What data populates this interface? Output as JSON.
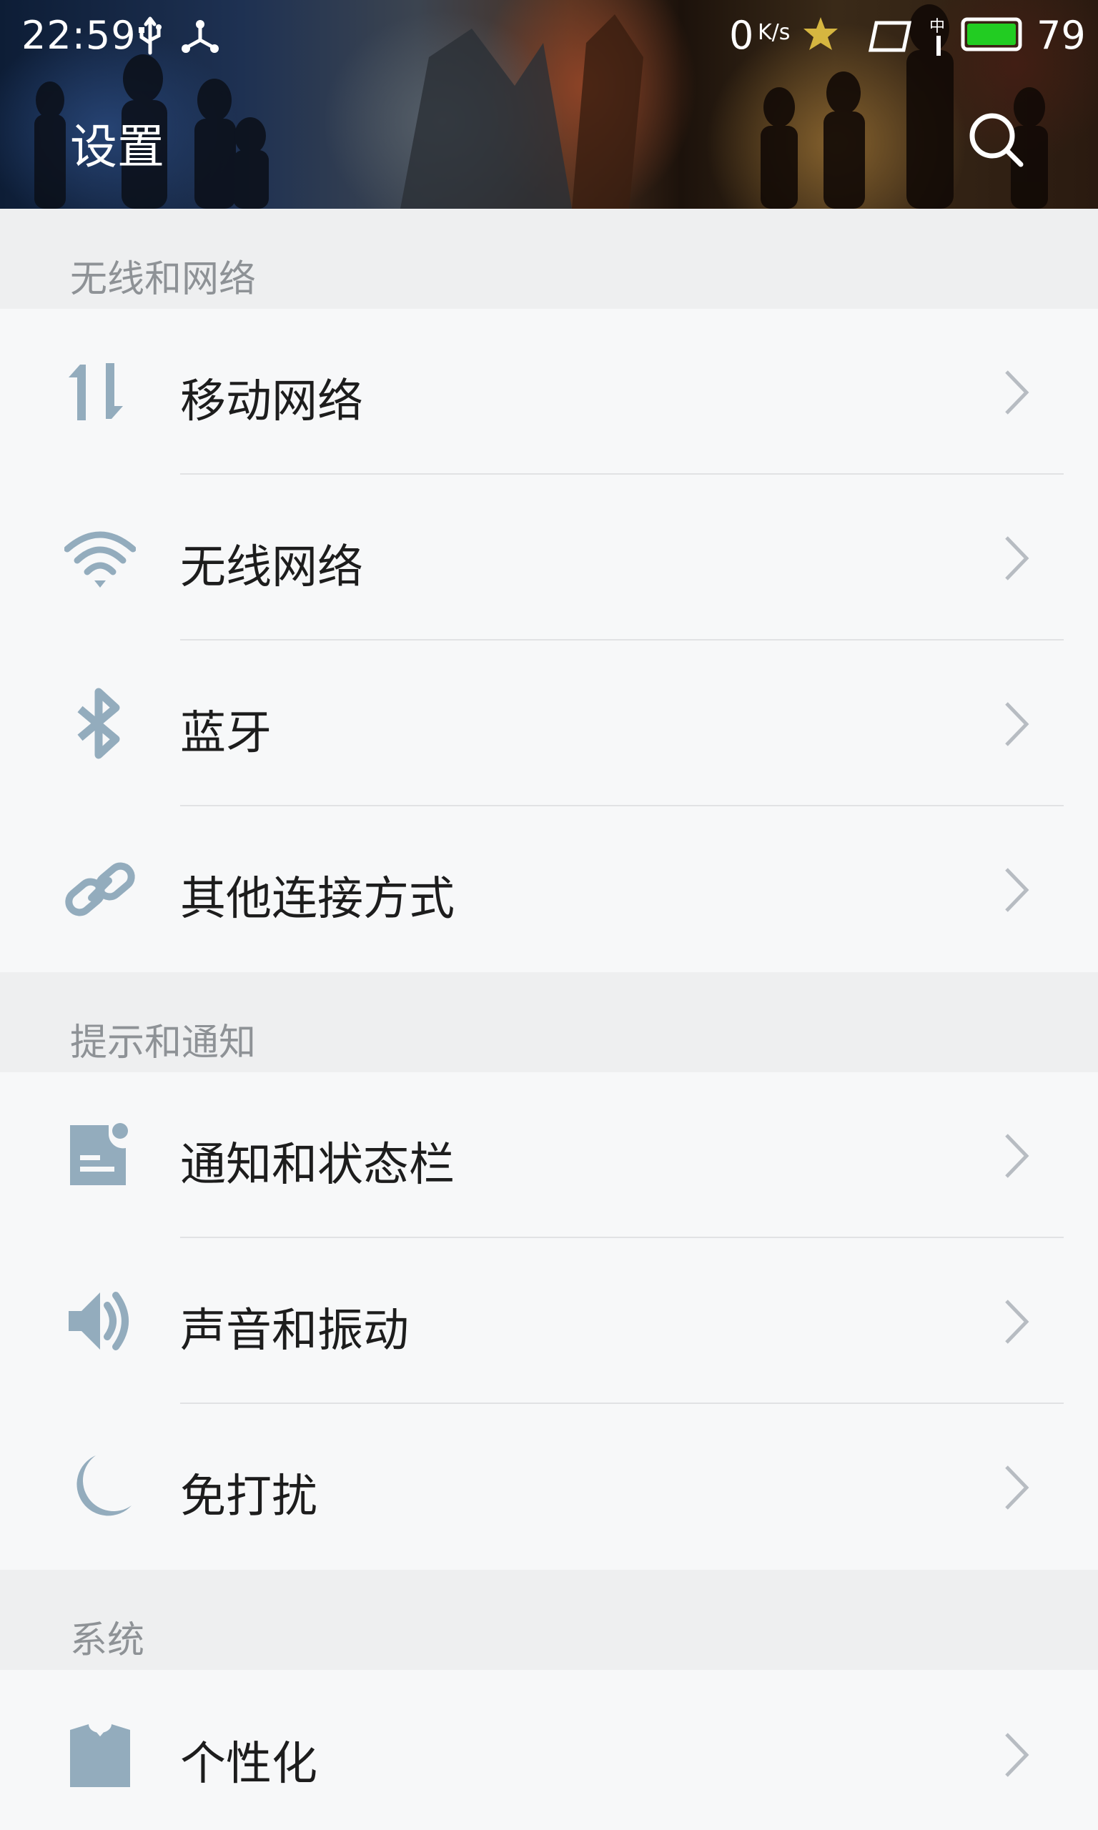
{
  "status_bar": {
    "time": "22:59",
    "net_speed": "0",
    "net_speed_unit": "K/s",
    "battery": "79",
    "battery_color": "#22cc22"
  },
  "header": {
    "title": "设置",
    "search_icon": "search-icon"
  },
  "colors": {
    "icon": "#93acbd",
    "chevron": "#b7bcc2",
    "section_bg": "#eeeff0",
    "row_bg": "#f7f8f9"
  },
  "sections": [
    {
      "title": "无线和网络",
      "items": [
        {
          "label": "移动网络",
          "icon": "mobile-data-icon"
        },
        {
          "label": "无线网络",
          "icon": "wifi-icon"
        },
        {
          "label": "蓝牙",
          "icon": "bluetooth-icon"
        },
        {
          "label": "其他连接方式",
          "icon": "link-icon"
        }
      ]
    },
    {
      "title": "提示和通知",
      "items": [
        {
          "label": "通知和状态栏",
          "icon": "notification-icon"
        },
        {
          "label": "声音和振动",
          "icon": "speaker-icon"
        },
        {
          "label": "免打扰",
          "icon": "moon-icon"
        }
      ]
    },
    {
      "title": "系统",
      "items": [
        {
          "label": "个性化",
          "icon": "tshirt-icon"
        }
      ]
    }
  ]
}
